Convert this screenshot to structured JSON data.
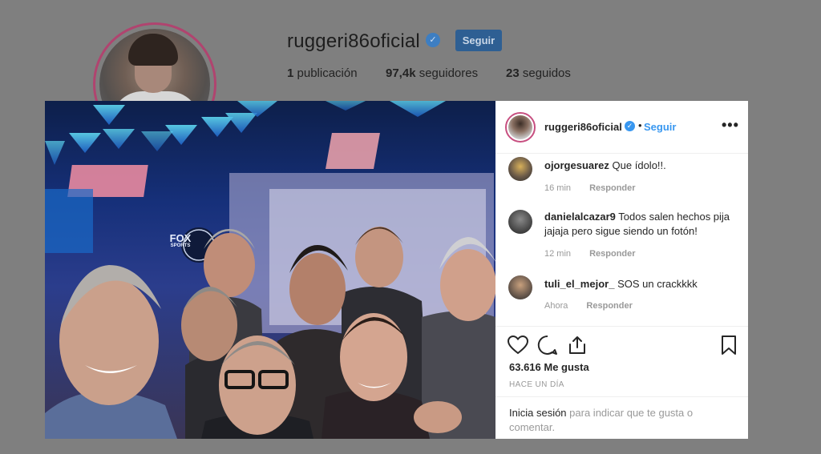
{
  "profile": {
    "username": "ruggeri86oficial",
    "follow_label": "Seguir",
    "stats": {
      "posts_count": "1",
      "posts_label": "publicación",
      "followers_count": "97,4k",
      "followers_label": "seguidores",
      "following_count": "23",
      "following_label": "seguidos"
    }
  },
  "post": {
    "header": {
      "username": "ruggeri86oficial",
      "separator": "•",
      "follow_label": "Seguir",
      "more_icon": "more-horizontal-icon"
    },
    "comments": [
      {
        "user": "ojorgesuarez",
        "text": "Que ídolo!!.",
        "time": "16 min",
        "reply_label": "Responder"
      },
      {
        "user": "danielalcazar9",
        "text": "Todos salen hechos pija jajaja pero sigue siendo un fotón!",
        "time": "12 min",
        "reply_label": "Responder"
      },
      {
        "user": "tuli_el_mejor_",
        "text": "SOS un crackkkk",
        "time": "Ahora",
        "reply_label": "Responder"
      }
    ],
    "likes": "63.616 Me gusta",
    "time_ago": "HACE UN DÍA",
    "login_prompt": {
      "link": "Inicia sesión",
      "rest": "para indicar que te gusta o comentar."
    },
    "photo_logo": {
      "line1": "FOX",
      "line2": "SPORTS"
    }
  },
  "colors": {
    "overlay": "#7f7f7f",
    "link_blue": "#3897f0",
    "text": "#262626",
    "muted": "#999999"
  }
}
